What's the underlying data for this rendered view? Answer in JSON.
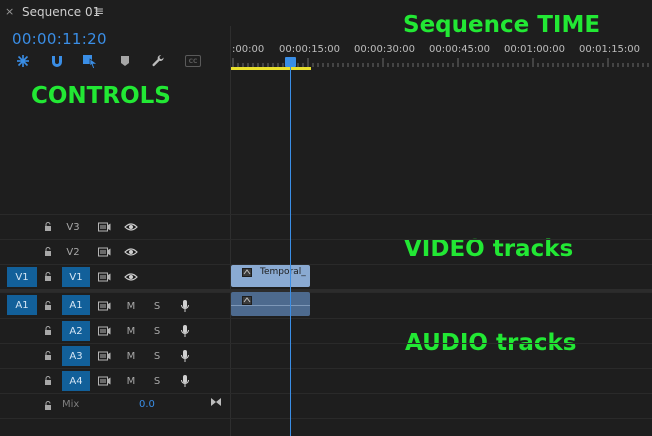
{
  "panel": {
    "close_glyph": "×",
    "title": "Sequence 01",
    "menu_glyph": "≡"
  },
  "timecode": "00:00:11:20",
  "ruler": {
    "labels": [
      ":00:00",
      "00:00:15:00",
      "00:00:30:00",
      "00:00:45:00",
      "00:01:00:00",
      "00:01:15:00"
    ]
  },
  "toolbar": {
    "cc_label": "CC"
  },
  "overlay": {
    "controls": "CONTROLS",
    "sequence_time": "Sequence TIME",
    "video_tracks": "VIDEO tracks",
    "audio_tracks": "AUDIO tracks"
  },
  "video_tracks": [
    {
      "source": "",
      "name": "V3"
    },
    {
      "source": "",
      "name": "V2"
    },
    {
      "source": "V1",
      "name": "V1"
    }
  ],
  "audio_tracks": [
    {
      "source": "A1",
      "name": "A1",
      "mute": "M",
      "solo": "S"
    },
    {
      "source": "",
      "name": "A2",
      "mute": "M",
      "solo": "S"
    },
    {
      "source": "",
      "name": "A3",
      "mute": "M",
      "solo": "S"
    },
    {
      "source": "",
      "name": "A4",
      "mute": "M",
      "solo": "S"
    }
  ],
  "mix": {
    "label": "Mix",
    "value": "0.0"
  },
  "clips": {
    "video_label": "Temporal_"
  },
  "colors": {
    "accent": "#3a8ee6",
    "track_target": "#12609a",
    "overlay": "#22e834",
    "work_area": "#e8e02c",
    "video_clip": "#8aaad2",
    "audio_clip": "#4d6a8e"
  }
}
